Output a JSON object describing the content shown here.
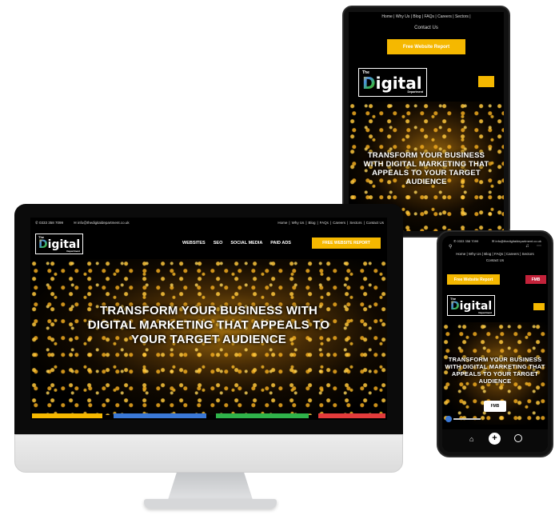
{
  "desktop": {
    "topbar": {
      "phone": "0333 358 7099",
      "email": "info@thedigitaldepartment.co.uk",
      "links": [
        "Home",
        "Why Us",
        "Blog",
        "FAQs",
        "Careers",
        "Sectors",
        "Contact Us"
      ]
    },
    "logo": {
      "the": "The",
      "main": "Digital",
      "sub": "Department"
    },
    "nav": [
      "WEBSITES",
      "SEO",
      "SOCIAL MEDIA",
      "PAID ADS"
    ],
    "cta": "FREE WEBSITE REPORT",
    "hero": [
      "TRANSFORM YOUR BUSINESS WITH",
      "DIGITAL MARKETING THAT APPEALS TO",
      "YOUR TARGET AUDIENCE"
    ],
    "bar_colors": [
      "#f5b800",
      "#3a78d6",
      "#2fb34a",
      "#e23b3b"
    ]
  },
  "tablet": {
    "topbar_links": "Home | Why Us | Blog | FAQs | Careers | Sectors |",
    "contact": "Contact Us",
    "cta": "Free Website Report",
    "logo": {
      "the": "The",
      "main": "Digital",
      "sub": "Department"
    },
    "hero": [
      "TRANSFORM YOUR BUSINESS",
      "WITH DIGITAL MARKETING THAT",
      "APPEALS TO YOUR TARGET",
      "AUDIENCE"
    ]
  },
  "phone": {
    "phone_number": "0333 358 7099",
    "email": "info@thedigitaldepartment.co.uk",
    "links": "Home | Why Us | Blog | FAQs | Careers | Sectors",
    "contact": "Contact Us",
    "cta": "Free Website Report",
    "fmb": "FMB",
    "logo": {
      "the": "The",
      "main": "Digital",
      "sub": "Department"
    },
    "hero": [
      "TRANSFORM YOUR BUSINESS",
      "WITH DIGITAL MARKETING THAT",
      "APPEALS TO YOUR TARGET",
      "AUDIENCE"
    ],
    "fmb_card": "FMB"
  }
}
